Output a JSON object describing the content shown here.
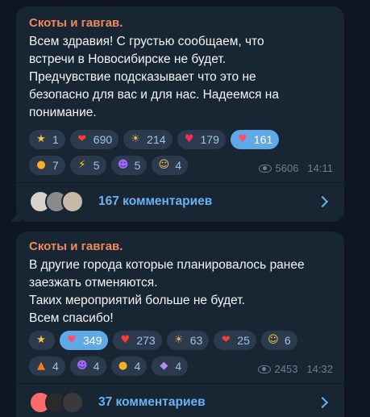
{
  "posts": [
    {
      "channel": "Скоты и гавгав.",
      "text": "Всем здравия! С грустью сообщаем, что\nвстречи в Новосибирске не будет.\nПредчувствие подсказывает что это не\nбезопасно для вас и для нас. Надеемся на\nпонимание.",
      "reactions_row1": [
        {
          "icon": "star-icon",
          "glyph": "★",
          "color": "#f5c542",
          "count": "1"
        },
        {
          "icon": "heart-on-fire-icon",
          "glyph": "❤",
          "color": "#ff3b30",
          "count": "690"
        },
        {
          "icon": "sun-icon",
          "glyph": "☀",
          "color": "#e8b45c",
          "count": "214"
        },
        {
          "icon": "red-heart-icon",
          "glyph": "♥",
          "color": "#ff2d55",
          "count": "179"
        },
        {
          "icon": "broken-heart-icon",
          "glyph": "♥",
          "color": "#ff4d6d",
          "count": "161",
          "selected": true
        }
      ],
      "reactions_row2": [
        {
          "icon": "pill-icon",
          "glyph": "●",
          "color": "#ffb020",
          "count": "7"
        },
        {
          "icon": "lightning-icon",
          "glyph": "⚡",
          "color": "#ffd60a",
          "count": "5"
        },
        {
          "icon": "smiling-devil-icon",
          "glyph": "☻",
          "color": "#a066ff",
          "count": "5"
        },
        {
          "icon": "exploding-head-icon",
          "glyph": "☺",
          "color": "#ffcc4d",
          "count": "4"
        }
      ],
      "views": "5606",
      "time": "14:11",
      "comments_label": "167 комментариев",
      "avatar_colors": [
        "#d9d2cc",
        "#8a8a8a",
        "#c9b9a8"
      ]
    },
    {
      "channel": "Скоты и гавгав.",
      "text": "В другие города которые планировалось ранее\nзаезжать отменяются.\nТаких мероприятий больше не будет.\nВсем спасибо!",
      "reactions_row1": [
        {
          "icon": "star-icon",
          "glyph": "★",
          "color": "#f5c542",
          "count": ""
        },
        {
          "icon": "broken-heart-icon",
          "glyph": "♥",
          "color": "#ff4d6d",
          "count": "349",
          "selected": true
        },
        {
          "icon": "broken-heart-icon",
          "glyph": "♥",
          "color": "#ff3b30",
          "count": "273"
        },
        {
          "icon": "sun-icon",
          "glyph": "☀",
          "color": "#e8b45c",
          "count": "63"
        },
        {
          "icon": "heart-on-fire-icon",
          "glyph": "❤",
          "color": "#ff3b30",
          "count": "25"
        },
        {
          "icon": "heart-eyes-icon",
          "glyph": "☺",
          "color": "#ffcc4d",
          "count": "6"
        }
      ],
      "reactions_row2": [
        {
          "icon": "fire-icon",
          "glyph": "▲",
          "color": "#ff7a1a",
          "count": "4"
        },
        {
          "icon": "smiling-devil-icon",
          "glyph": "☻",
          "color": "#a066ff",
          "count": "4"
        },
        {
          "icon": "pill-icon",
          "glyph": "●",
          "color": "#ffb020",
          "count": "4"
        },
        {
          "icon": "alien-monster-icon",
          "glyph": "◆",
          "color": "#b58cff",
          "count": "4"
        }
      ],
      "views": "2453",
      "time": "14:32",
      "comments_label": "37 комментариев",
      "avatar_colors": [
        "#ff6b6b",
        "#2a2a2a",
        "#3a3a3a"
      ]
    }
  ]
}
